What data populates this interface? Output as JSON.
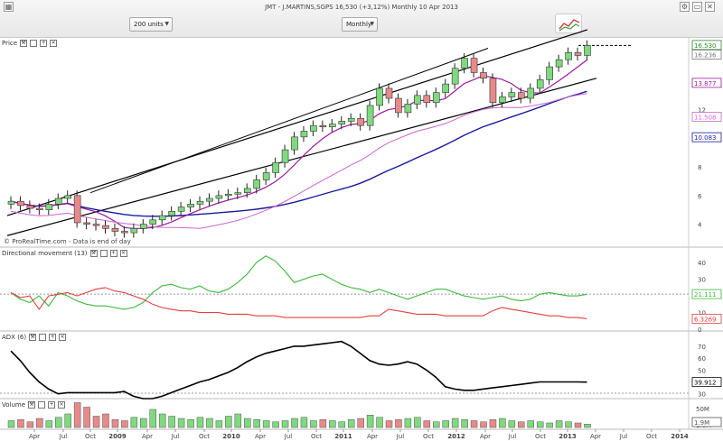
{
  "title": "JMT - J.MARTINS,SGPS    16,530 (+3,12%)    Monthly  10 Apr 2013",
  "toolbar": {
    "units_select": "200 units",
    "interval_select": "Monthly",
    "icons": [
      "chart-type-icon",
      "settings-icon",
      "window-icon",
      "close-icon"
    ]
  },
  "panes": {
    "price": {
      "label": "Price"
    },
    "dmi": {
      "label": "Directional movement (13)"
    },
    "adx": {
      "label": "ADX (6)"
    },
    "volume": {
      "label": "Volume"
    }
  },
  "price_axis": {
    "ticks": [
      "16",
      "14",
      "12",
      "10",
      "8",
      "6",
      "4"
    ],
    "tags": {
      "last": "16.530",
      "prev": "16.236",
      "upper": "13.877",
      "mid": "11.508",
      "lower": "10.083"
    }
  },
  "dmi_axis": {
    "ticks": [
      "40",
      "30",
      "20",
      "10",
      "0"
    ],
    "tags": {
      "plus": "21.111",
      "minus": "6.3269"
    }
  },
  "adx_axis": {
    "ticks": [
      "70",
      "60",
      "50",
      "40",
      "30"
    ],
    "tags": {
      "adx": "39.912"
    }
  },
  "volume_axis": {
    "ticks": [
      "50M",
      "1.8M"
    ],
    "tags": {
      "last": "1.9M"
    }
  },
  "time_axis": [
    "Apr",
    "Jul",
    "Oct",
    "2009",
    "Apr",
    "Jul",
    "Oct",
    "2010",
    "Apr",
    "Jul",
    "Oct",
    "2011",
    "Apr",
    "Jul",
    "Oct",
    "2012",
    "Apr",
    "Jul",
    "Oct",
    "2013",
    "Apr",
    "Jul",
    "Oct",
    "2014"
  ],
  "watermark": "© ProRealTime.com - Data is end of day",
  "colors": {
    "up": "#7fd97f",
    "down": "#e88a8a",
    "channel": "#000000",
    "ma_dark": "#1a1aa0",
    "ma_mid": "#9a1a9a",
    "ma_light": "#cc66cc",
    "plus_di": "#3cb83c",
    "minus_di": "#e04040",
    "adx": "#000000"
  },
  "chart_data": {
    "type": "candlestick",
    "interval": "monthly",
    "closes": [
      5.6,
      5.3,
      5.1,
      5.0,
      5.4,
      5.8,
      6.0,
      4.1,
      4.0,
      3.9,
      3.7,
      3.5,
      3.4,
      3.7,
      4.0,
      4.3,
      4.6,
      4.9,
      5.2,
      5.4,
      5.6,
      5.8,
      6.0,
      6.1,
      6.2,
      6.5,
      7.1,
      7.6,
      8.3,
      9.2,
      10.1,
      10.5,
      10.9,
      10.8,
      11.0,
      11.2,
      11.4,
      10.9,
      12.3,
      13.5,
      12.8,
      11.8,
      12.4,
      13.0,
      12.5,
      13.2,
      13.8,
      14.9,
      15.6,
      14.6,
      14.2,
      12.5,
      12.9,
      13.2,
      12.8,
      13.5,
      14.1,
      15.0,
      15.5,
      16.0,
      15.8,
      16.5
    ],
    "adx_last": 39.912,
    "plus_di_last": 21.111,
    "minus_di_last": 6.3269
  }
}
